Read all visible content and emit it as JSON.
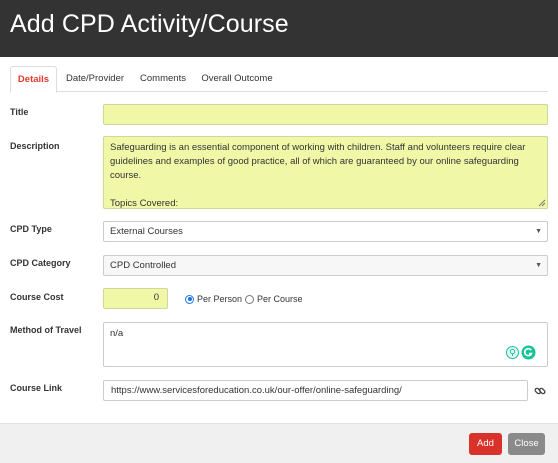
{
  "modal": {
    "title": "Add CPD Activity/Course"
  },
  "tabs": [
    {
      "label": "Details"
    },
    {
      "label": "Date/Provider"
    },
    {
      "label": "Comments"
    },
    {
      "label": "Overall Outcome"
    }
  ],
  "form": {
    "title": {
      "label": "Title",
      "value": ""
    },
    "description": {
      "label": "Description",
      "value": "Safeguarding is an essential component of working with children. Staff and volunteers require clear guidelines and examples of good practice, all of which are guaranteed by our online safeguarding course.\n\nTopics Covered:\nThe difference between ‘Child Protection’ and ‘Safeguarding’"
    },
    "cpd_type": {
      "label": "CPD Type",
      "value": "External Courses"
    },
    "cpd_category": {
      "label": "CPD Category",
      "value": "CPD Controlled"
    },
    "course_cost": {
      "label": "Course Cost",
      "value": "0",
      "option_per_person": "Per Person",
      "option_per_course": "Per Course",
      "selected": "Per Person"
    },
    "method_of_travel": {
      "label": "Method of Travel",
      "value": "n/a"
    },
    "course_link": {
      "label": "Course Link",
      "value": "https://www.servicesforeducation.co.uk/our-offer/online-safeguarding/"
    }
  },
  "footer": {
    "add_label": "Add",
    "close_label": "Close"
  },
  "colors": {
    "header_bg": "#333333",
    "accent": "#d9322a",
    "field_highlight": "#f0f8a8",
    "radio_checked": "#1a73e8"
  },
  "icons": [
    "chevron-down-icon",
    "link-icon",
    "grammarly-icon",
    "lightbulb-icon",
    "resize-grip-icon"
  ]
}
